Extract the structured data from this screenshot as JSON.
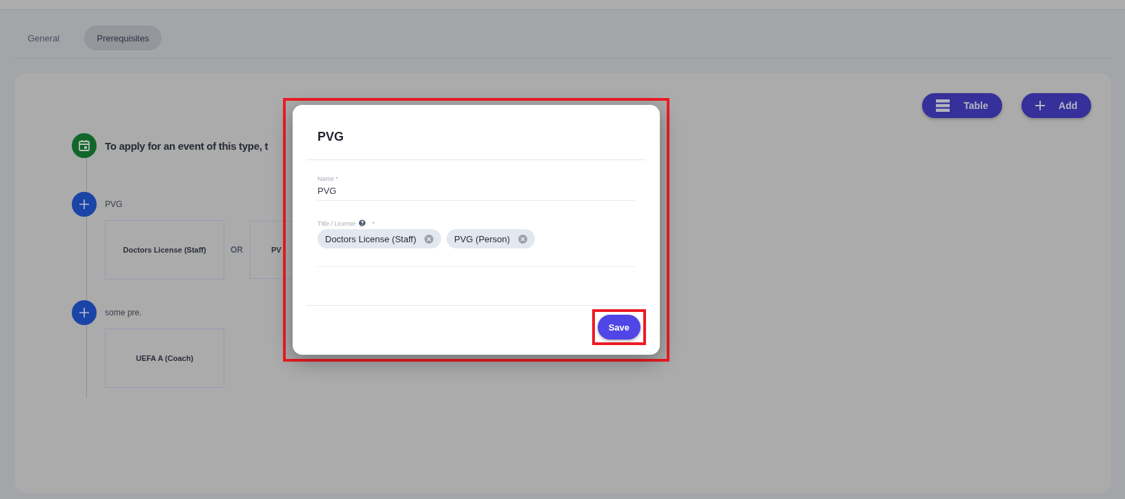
{
  "tabs": [
    {
      "label": "General",
      "selected": false
    },
    {
      "label": "Prerequisites",
      "selected": true
    }
  ],
  "toolbar": [
    {
      "kind": "table",
      "label": "Table"
    },
    {
      "kind": "add",
      "label": "Add"
    }
  ],
  "timeline": {
    "heading": "To apply for an event of this type, t",
    "groups": [
      {
        "label": "PVG",
        "separator": "OR",
        "items": [
          "Doctors License (Staff)",
          "PV"
        ]
      },
      {
        "label": "some pre.",
        "items": [
          "UEFA A (Coach)"
        ]
      }
    ]
  },
  "dialog": {
    "title": "PVG",
    "highlighted": true,
    "fields": [
      {
        "kind": "text",
        "label": "Name *",
        "value": "PVG"
      },
      {
        "kind": "chips",
        "label": "Title / License",
        "required_mark": "*",
        "chips": [
          "Doctors License (Staff)",
          "PVG (Person)"
        ]
      }
    ],
    "save_button": {
      "label": "Save",
      "highlighted": true
    }
  }
}
